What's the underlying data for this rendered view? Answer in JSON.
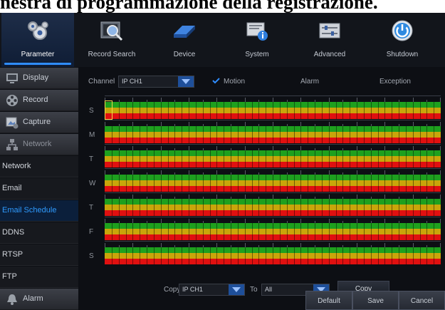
{
  "caption": "nestra di programmazione della registrazione.",
  "nav": {
    "tabs": [
      {
        "label": "Parameter",
        "icon": "gears-icon",
        "active": true
      },
      {
        "label": "Record Search",
        "icon": "film-magnifier-icon",
        "active": false
      },
      {
        "label": "Device",
        "icon": "hard-drive-icon",
        "active": false
      },
      {
        "label": "System",
        "icon": "info-monitor-icon",
        "active": false
      },
      {
        "label": "Advanced",
        "icon": "sliders-icon",
        "active": false
      },
      {
        "label": "Shutdown",
        "icon": "power-icon",
        "active": false
      }
    ]
  },
  "sidebar": {
    "display": "Display",
    "record": "Record",
    "capture": "Capture",
    "network": "Network",
    "sub_network": "Network",
    "email": "Email",
    "email_schedule": "Email Schedule",
    "ddns": "DDNS",
    "rtsp": "RTSP",
    "ftp": "FTP",
    "alarm": "Alarm"
  },
  "schedule": {
    "channel_label": "Channel",
    "channel_value": "IP CH1",
    "motion_label": "Motion",
    "motion_checked": true,
    "alarm_label": "Alarm",
    "exception_label": "Exception",
    "days": [
      "S",
      "M",
      "T",
      "W",
      "T",
      "F",
      "S"
    ],
    "colors": {
      "motion": "#1ea01e",
      "alarm": "#c9a50a",
      "exception": "#e01010",
      "accent": "#2f8dff"
    }
  },
  "copy": {
    "copy_label": "Copy",
    "from_value": "IP CH1",
    "to_label": "To",
    "to_value": "All",
    "button": "Copy"
  },
  "footer": {
    "default": "Default",
    "save": "Save",
    "cancel": "Cancel"
  }
}
